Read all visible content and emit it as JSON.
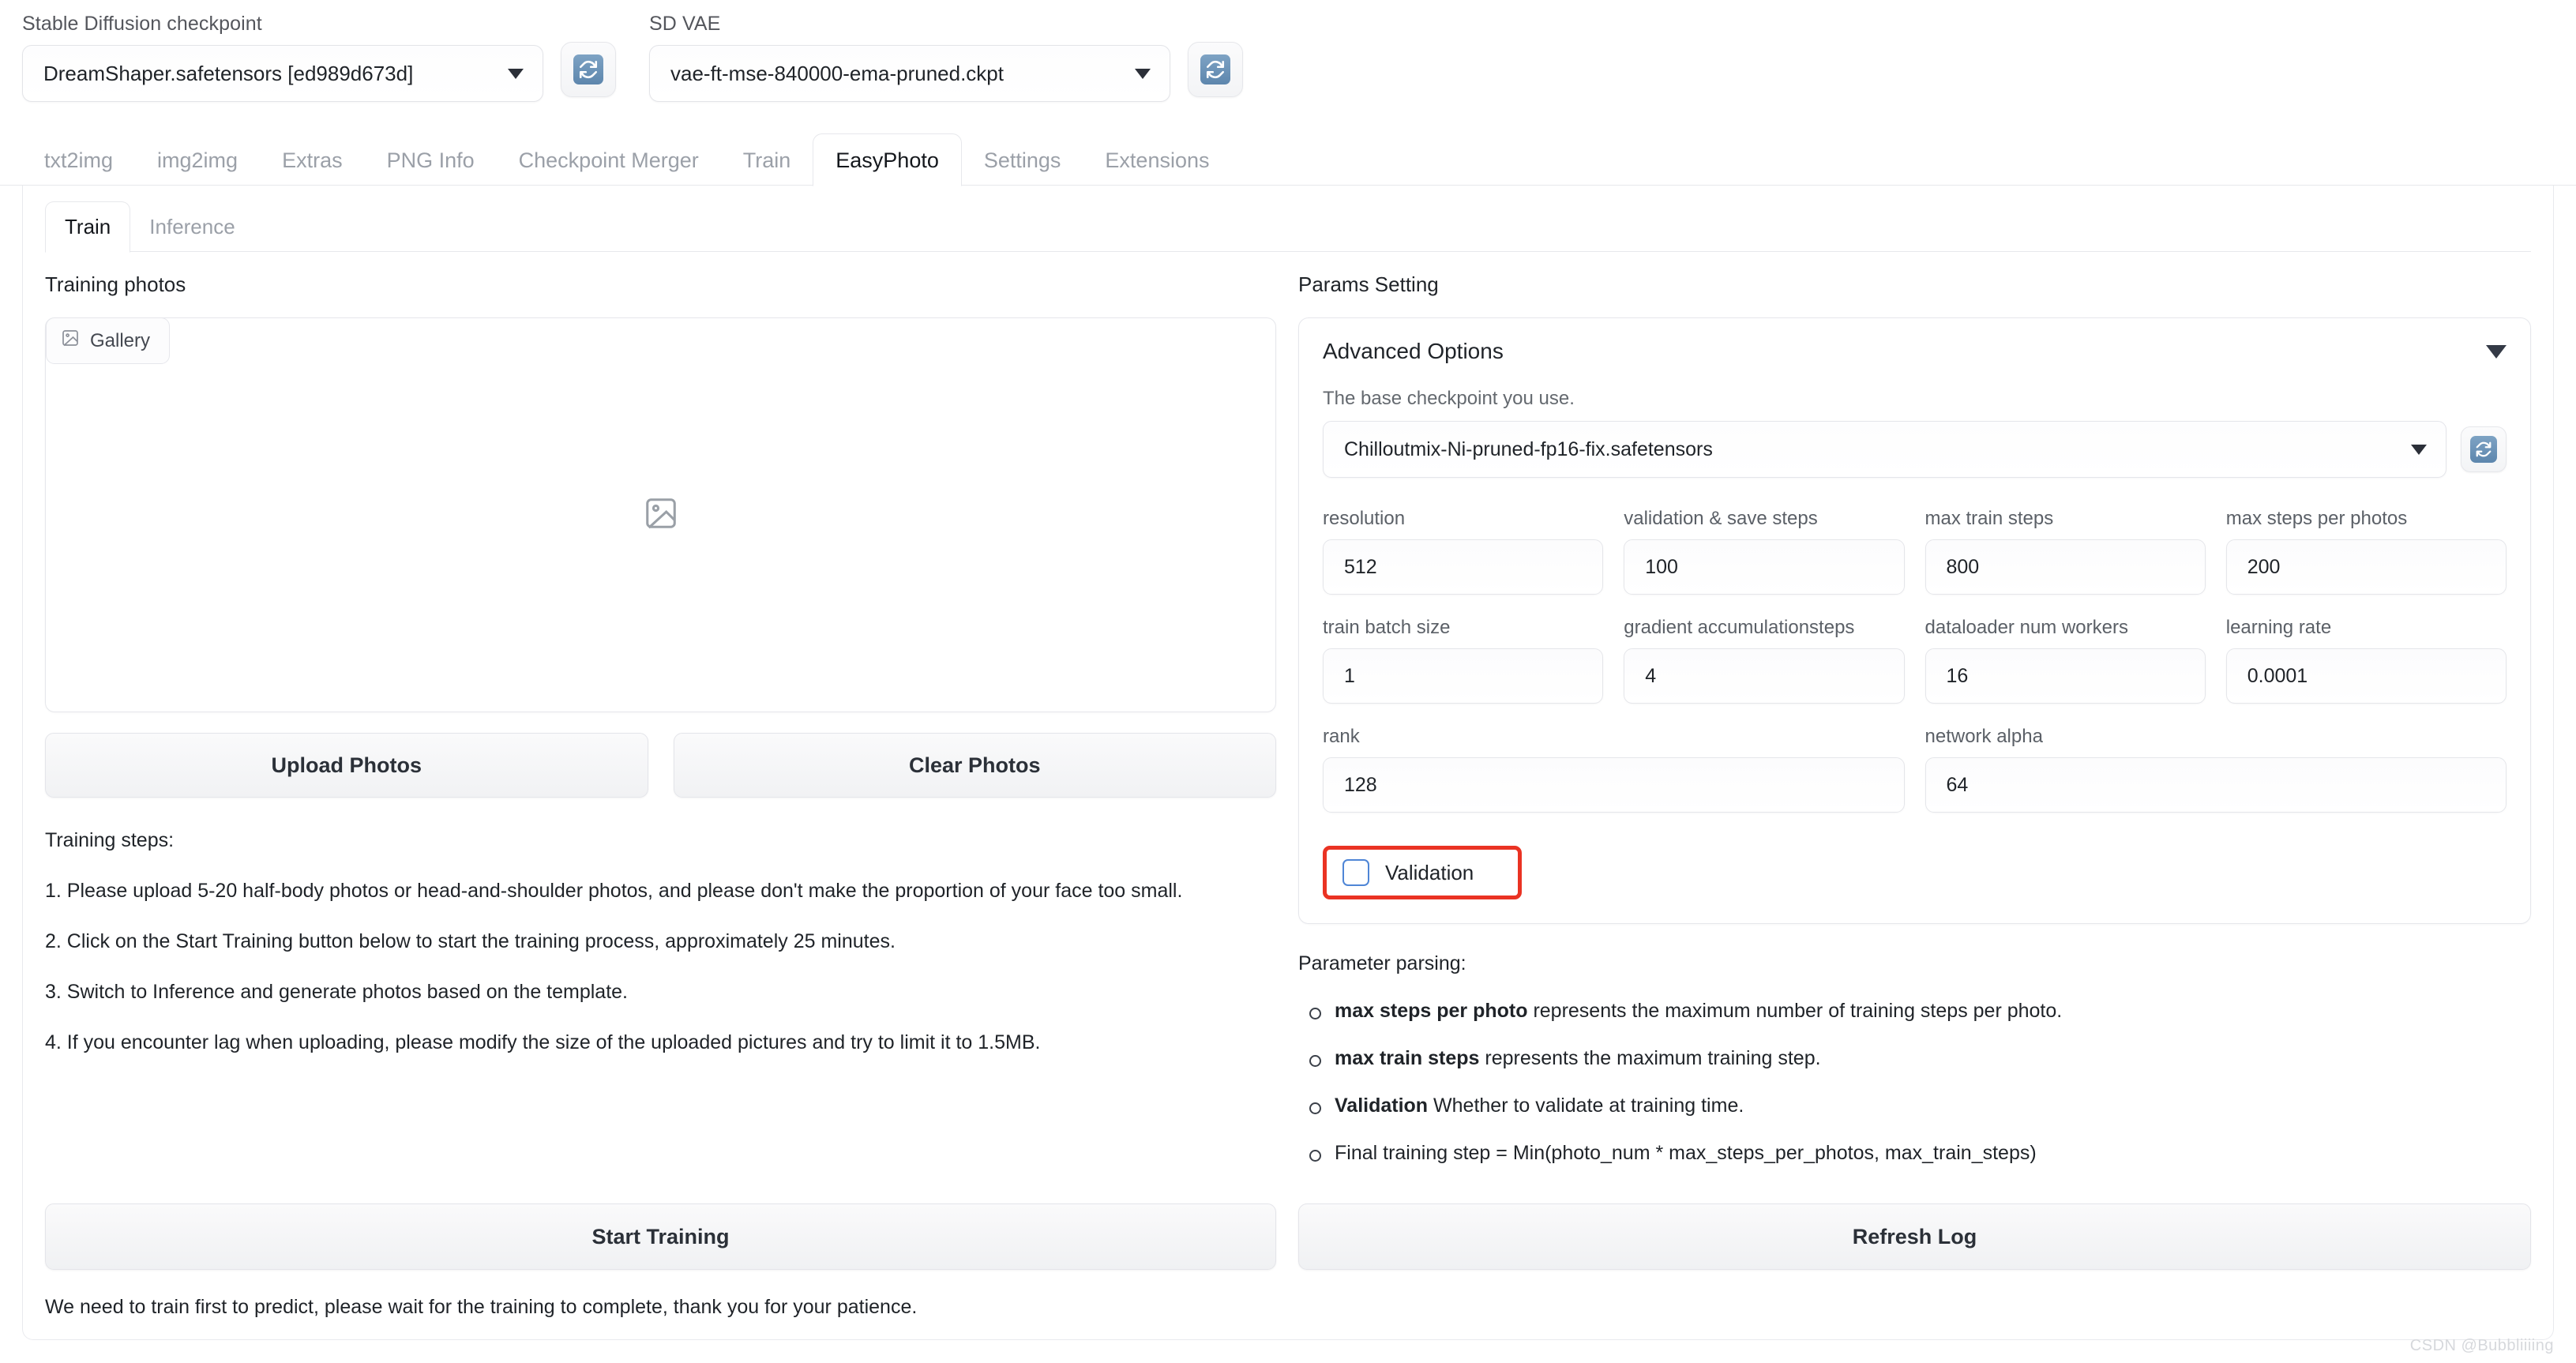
{
  "topbar": {
    "checkpoint": {
      "label": "Stable Diffusion checkpoint",
      "value": "DreamShaper.safetensors [ed989d673d]"
    },
    "vae": {
      "label": "SD VAE",
      "value": "vae-ft-mse-840000-ema-pruned.ckpt"
    },
    "refresh_icon": "refresh-icon"
  },
  "tabs": [
    {
      "label": "txt2img",
      "active": false
    },
    {
      "label": "img2img",
      "active": false
    },
    {
      "label": "Extras",
      "active": false
    },
    {
      "label": "PNG Info",
      "active": false
    },
    {
      "label": "Checkpoint Merger",
      "active": false
    },
    {
      "label": "Train",
      "active": false
    },
    {
      "label": "EasyPhoto",
      "active": true
    },
    {
      "label": "Settings",
      "active": false
    },
    {
      "label": "Extensions",
      "active": false
    }
  ],
  "subtabs": [
    {
      "label": "Train",
      "active": true
    },
    {
      "label": "Inference",
      "active": false
    }
  ],
  "left": {
    "title": "Training photos",
    "gallery_chip": "Gallery",
    "gallery_icon": "image-placeholder-icon",
    "upload_button": "Upload Photos",
    "clear_button": "Clear Photos",
    "steps_title": "Training steps:",
    "steps": [
      "1. Please upload 5-20 half-body photos or head-and-shoulder photos, and please don't make the proportion of your face too small.",
      "2. Click on the Start Training button below to start the training process, approximately 25 minutes.",
      "3. Switch to Inference and generate photos based on the template.",
      "4. If you encounter lag when uploading, please modify the size of the uploaded pictures and try to limit it to 1.5MB."
    ],
    "start_button": "Start Training",
    "footer_note": "We need to train first to predict, please wait for the training to complete, thank you for your patience."
  },
  "right": {
    "title": "Params Setting",
    "advanced_title": "Advanced Options",
    "collapse_icon": "triangle-down-icon",
    "base_checkpoint_hint": "The base checkpoint you use.",
    "base_checkpoint_value": "Chilloutmix-Ni-pruned-fp16-fix.safetensors",
    "params": [
      {
        "label": "resolution",
        "value": "512"
      },
      {
        "label": "validation & save steps",
        "value": "100"
      },
      {
        "label": "max train steps",
        "value": "800"
      },
      {
        "label": "max steps per photos",
        "value": "200"
      },
      {
        "label": "train batch size",
        "value": "1"
      },
      {
        "label": "gradient accumulationsteps",
        "value": "4"
      },
      {
        "label": "dataloader num workers",
        "value": "16"
      },
      {
        "label": "learning rate",
        "value": "0.0001"
      }
    ],
    "params_wide": [
      {
        "label": "rank",
        "value": "128"
      },
      {
        "label": "network alpha",
        "value": "64"
      }
    ],
    "validation_label": "Validation",
    "validation_checked": false,
    "highlight_color": "#ea3323",
    "parse_title": "Parameter parsing:",
    "parse_items": [
      {
        "bold": "max steps per photo",
        "rest": " represents the maximum number of training steps per photo."
      },
      {
        "bold": "max train steps",
        "rest": " represents the maximum training step."
      },
      {
        "bold": "Validation",
        "rest": " Whether to validate at training time."
      },
      {
        "bold": "",
        "rest": "Final training step = Min(photo_num * max_steps_per_photos, max_train_steps)"
      }
    ],
    "refresh_log_button": "Refresh Log"
  },
  "watermark": "CSDN @Bubbliiiing"
}
